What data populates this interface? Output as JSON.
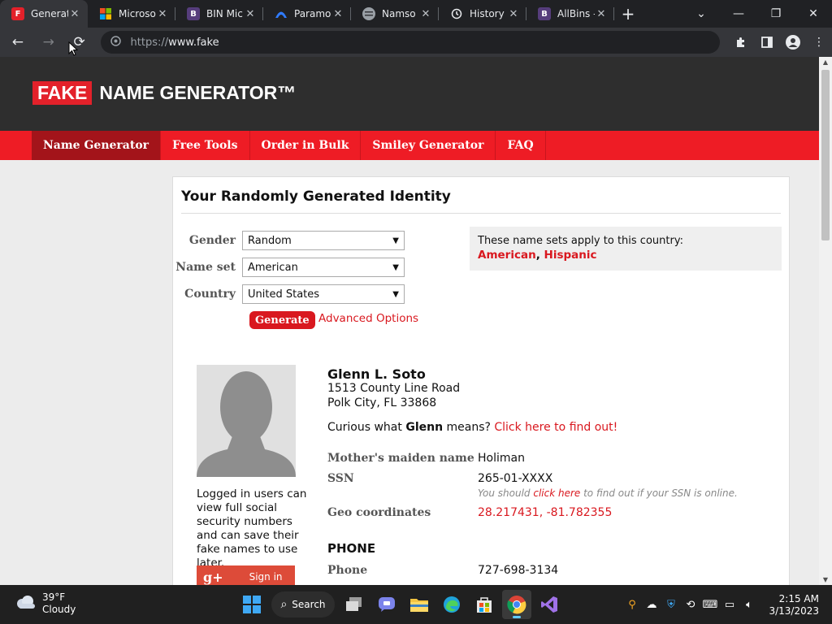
{
  "browser": {
    "tabs": [
      {
        "title": "Generat",
        "icon": "fake-name-favicon",
        "color": "#e3212a",
        "glyph": "F",
        "active": true
      },
      {
        "title": "Microso",
        "icon": "microsoft-favicon",
        "color": "#f25022",
        "glyph": "",
        "active": false
      },
      {
        "title": "BIN Mic",
        "icon": "bootstrap-favicon",
        "color": "#563d7c",
        "glyph": "B",
        "active": false
      },
      {
        "title": "Paramo",
        "icon": "paramount-favicon",
        "color": "#0064ff",
        "glyph": "",
        "active": false
      },
      {
        "title": "Namso",
        "icon": "namso-favicon",
        "color": "#9aa0a6",
        "glyph": "",
        "active": false
      },
      {
        "title": "History",
        "icon": "history-favicon",
        "color": "#35363a",
        "glyph": "",
        "active": false
      },
      {
        "title": "AllBins -",
        "icon": "bootstrap-favicon",
        "color": "#563d7c",
        "glyph": "B",
        "active": false
      }
    ],
    "new_tab_symbol": "+",
    "window_controls": {
      "menu": "⌄",
      "minimize": "—",
      "restore": "❐",
      "close": "✕"
    },
    "address": {
      "scheme": "https://",
      "host": "www.fake"
    }
  },
  "site": {
    "logo": {
      "badge": "FAKE",
      "text": "NAME GENERATOR™"
    },
    "nav": [
      {
        "label": "Name Generator",
        "active": true
      },
      {
        "label": "Free Tools",
        "active": false
      },
      {
        "label": "Order in Bulk",
        "active": false
      },
      {
        "label": "Smiley Generator",
        "active": false
      },
      {
        "label": "FAQ",
        "active": false
      }
    ]
  },
  "generator": {
    "heading": "Your Randomly Generated Identity",
    "fields": {
      "gender": {
        "label": "Gender",
        "value": "Random"
      },
      "nameset": {
        "label": "Name set",
        "value": "American"
      },
      "country": {
        "label": "Country",
        "value": "United States"
      }
    },
    "generate_label": "Generate",
    "advanced_label": "Advanced Options",
    "countrybox": {
      "text": "These name sets apply to this country:",
      "set1": "American",
      "set2": "Hispanic"
    }
  },
  "identity": {
    "name": "Glenn L. Soto",
    "address_line1": "1513 County Line Road",
    "address_line2": "Polk City, FL 33868",
    "curious_prefix": "Curious what ",
    "first_name": "Glenn",
    "curious_mid": " means? ",
    "curious_link": "Click here to find out!",
    "maiden": {
      "label": "Mother's maiden name",
      "value": "Holiman"
    },
    "ssn": {
      "label": "SSN",
      "value": "265-01-XXXX"
    },
    "ssn_note": {
      "prefix": "You should ",
      "link": "click here",
      "suffix": " to find out if your SSN is online."
    },
    "geo": {
      "label": "Geo coordinates",
      "value": "28.217431, -81.782355"
    },
    "phone_header": "PHONE",
    "phone": {
      "label": "Phone",
      "value": "727-698-3134"
    }
  },
  "sidebar": {
    "login_note": "Logged in users can view full social security numbers and can save their fake names to use later.",
    "gplus_label": "Sign in",
    "gplus_glyph": "g+"
  },
  "taskbar": {
    "weather_temp": "39°F",
    "weather_desc": "Cloudy",
    "search_label": "Search",
    "time": "2:15 AM",
    "date": "3/13/2023"
  }
}
